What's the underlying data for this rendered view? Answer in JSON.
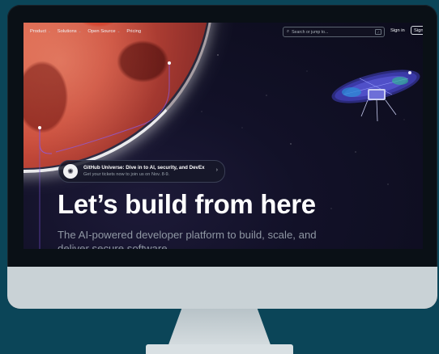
{
  "nav": {
    "items": [
      {
        "label": "Product",
        "has_dropdown": true
      },
      {
        "label": "Solutions",
        "has_dropdown": true
      },
      {
        "label": "Open Source",
        "has_dropdown": true
      },
      {
        "label": "Pricing",
        "has_dropdown": false
      }
    ],
    "search_placeholder": "Search or jump to...",
    "search_shortcut": "/",
    "signin_label": "Sign in",
    "signup_label": "Sign"
  },
  "banner": {
    "title": "GitHub Universe: Dive in to AI, security, and DevEx",
    "subtitle": "Get your tickets now to join us on Nov. 8-9.",
    "badge_icon": "universe-logo-icon",
    "arrow_icon": "chevron-right-icon"
  },
  "hero": {
    "headline": "Let’s build from here",
    "subheadline": "The AI-powered developer platform to build, scale, and deliver secure software."
  },
  "colors": {
    "page_background": "#0b4558",
    "screen_background": "#121128",
    "planet": "#c94b3a",
    "headline": "#ffffff",
    "subheadline": "#8f97a3",
    "trace_line": "#8a5cf0",
    "monitor_chin": "#c9d2d6"
  }
}
